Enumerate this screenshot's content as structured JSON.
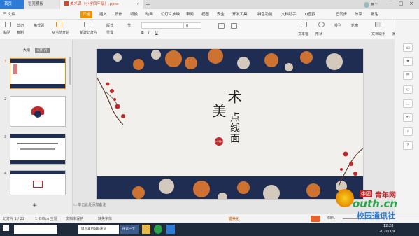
{
  "tabs": {
    "home": "首页",
    "template": "稻壳模板",
    "doc": "美术课（小学四年级）.pptx",
    "plus": "+"
  },
  "window": {
    "user": "两个"
  },
  "menu": [
    "三 文件",
    "开始",
    "插入",
    "设计",
    "切换",
    "动画",
    "幻灯片放映",
    "审阅",
    "视图",
    "安全",
    "开发工具",
    "特色功能",
    "文档助手",
    "Q查找"
  ],
  "menu_right": {
    "sync": "已同步",
    "share": "分享",
    "comment": "批注"
  },
  "ribbon": {
    "paste": "粘贴",
    "cut": "剪切",
    "copy": "复制",
    "format_painter": "格式刷",
    "play_from_current": "从当前开始",
    "new_slide": "新建幻灯片",
    "layout": "版式",
    "section": "节",
    "reset": "重置",
    "font_size": "0",
    "textbox": "文本框",
    "shape": "形状",
    "arrange": "排列",
    "outline": "轮廓",
    "doc_assistant": "文档助手",
    "slideshow_tool": "演示工具"
  },
  "left_panel": {
    "outline_tab": "大纲",
    "slides_tab": "幻灯片",
    "nums": [
      "1",
      "2",
      "3",
      "4"
    ],
    "add": "+"
  },
  "slide": {
    "chars_big": "美",
    "chars_col": "术",
    "chars_col2": "点线面",
    "seal": "小学美术"
  },
  "notes": {
    "placeholder": "单击此处添加备注"
  },
  "status": {
    "slide_info": "幻灯片 1 / 22",
    "theme": "1_Office 主题",
    "doc_protect": "文档未保护",
    "missing_font": "缺失字体",
    "beautify": "一键美化",
    "zoom": "68%"
  },
  "taskbar": {
    "search": "键您拿用敲数压词",
    "item1": "搜索一下",
    "time": "12:28",
    "date": "2020/3/9"
  },
  "watermark": {
    "cn": "中國",
    "youth_net": "青年网",
    "domain": "outh.cn",
    "school": "校园通讯社"
  },
  "colors": {
    "accent": "#f39200",
    "home_tab": "#2e7bd6",
    "navy": "#1f2d52",
    "red": "#c0282c"
  }
}
